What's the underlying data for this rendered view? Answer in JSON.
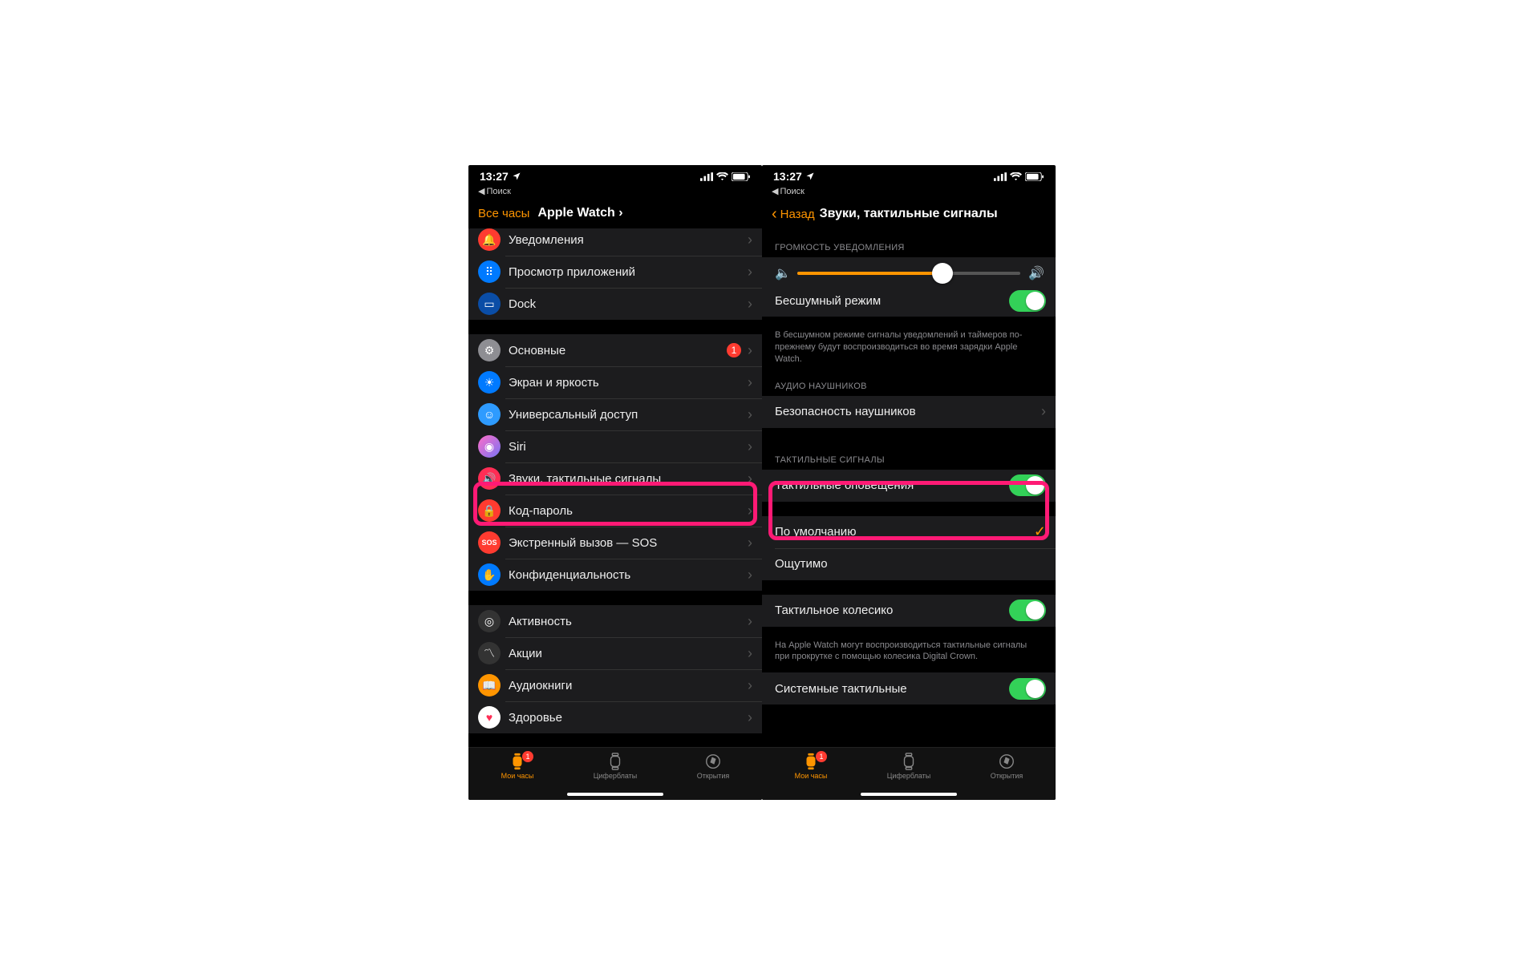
{
  "status": {
    "time": "13:27",
    "back_search": "Поиск"
  },
  "left": {
    "nav": {
      "all_watches": "Все часы",
      "title": "Apple Watch"
    },
    "group1": [
      {
        "id": "notifications",
        "label": "Уведомления"
      },
      {
        "id": "app-layout",
        "label": "Просмотр приложений"
      },
      {
        "id": "dock",
        "label": "Dock"
      }
    ],
    "group2": [
      {
        "id": "general",
        "label": "Основные",
        "badge": "1"
      },
      {
        "id": "display",
        "label": "Экран и яркость"
      },
      {
        "id": "accessibility",
        "label": "Универсальный доступ"
      },
      {
        "id": "siri",
        "label": "Siri"
      },
      {
        "id": "sounds",
        "label": "Звуки, тактильные сигналы"
      },
      {
        "id": "passcode",
        "label": "Код-пароль"
      },
      {
        "id": "sos",
        "label": "Экстренный вызов — SOS"
      },
      {
        "id": "privacy",
        "label": "Конфиденциальность"
      }
    ],
    "group3": [
      {
        "id": "activity",
        "label": "Активность"
      },
      {
        "id": "stocks",
        "label": "Акции"
      },
      {
        "id": "audiobooks",
        "label": "Аудиокниги"
      },
      {
        "id": "health",
        "label": "Здоровье"
      }
    ]
  },
  "right": {
    "nav": {
      "back": "Назад",
      "title": "Звуки, тактильные сигналы"
    },
    "vol_header": "ГРОМКОСТЬ УВЕДОМЛЕНИЯ",
    "silent_label": "Бесшумный режим",
    "silent_footer": "В бесшумном режиме сигналы уведомлений и таймеров по-прежнему будут воспроизводиться во время зарядки Apple Watch.",
    "audio_header": "АУДИО НАУШНИКОВ",
    "headphone_safety": "Безопасность наушников",
    "haptic_header": "ТАКТИЛЬНЫЕ СИГНАЛЫ",
    "haptic_alerts": "Тактильные оповещения",
    "default": "По умолчанию",
    "prominent": "Ощутимо",
    "crown_label": "Тактильное колесико",
    "crown_footer": "На Apple Watch могут воспроизводиться тактильные сигналы при прокрутке с помощью колесика Digital Crown.",
    "system_label": "Системные тактильные"
  },
  "tabs": {
    "watch": "Мои часы",
    "faces": "Циферблаты",
    "discover": "Открытия",
    "badge": "1"
  }
}
